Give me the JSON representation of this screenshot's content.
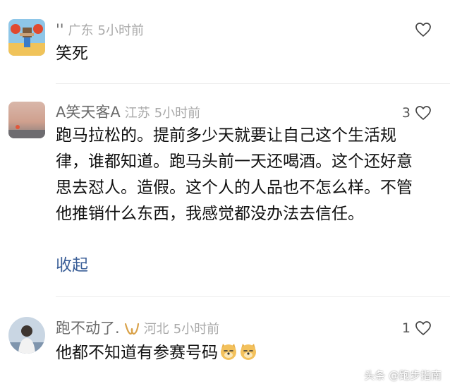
{
  "comments": [
    {
      "name": "''",
      "location": "广东",
      "time": "5小时前",
      "text": "笑死",
      "likes": ""
    },
    {
      "name": "A笑天客A",
      "location": "江苏",
      "time": "5小时前",
      "text": "跑马拉松的。提前多少天就要让自己这个生活规律，谁都知道。跑马头前一天还喝酒。这个还好意思去怼人。造假。这个人的人品也不怎么样。不管他推销什么东西，我感觉都没办法去信任。",
      "collapse_label": "收起",
      "likes": "3"
    },
    {
      "name": "跑不动了.",
      "location": "河北",
      "time": "5小时前",
      "text": "他都不知道有参赛号码",
      "likes": "1"
    }
  ],
  "watermark": "头条 @跑步指南",
  "colors": {
    "link": "#3a5e97",
    "meta": "#a9a9a9",
    "name": "#6b6b6b",
    "badge": "#d9a24a"
  },
  "icons": [
    "heart-outline-icon",
    "member-badge-icon",
    "doge-emoji-icon"
  ]
}
